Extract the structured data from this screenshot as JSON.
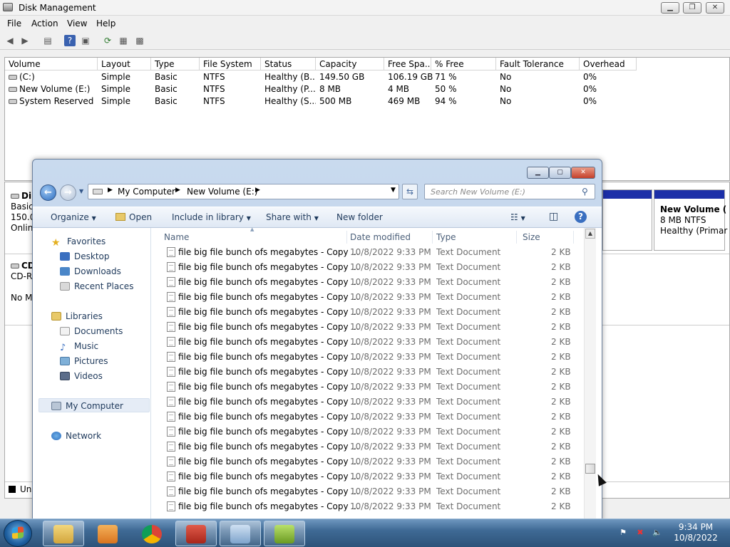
{
  "disk_mgmt": {
    "title": "Disk Management",
    "menu": [
      "File",
      "Action",
      "View",
      "Help"
    ],
    "columns": [
      "Volume",
      "Layout",
      "Type",
      "File System",
      "Status",
      "Capacity",
      "Free Spa...",
      "% Free",
      "Fault Tolerance",
      "Overhead"
    ],
    "rows": [
      [
        "(C:)",
        "Simple",
        "Basic",
        "NTFS",
        "Healthy (B...",
        "149.50 GB",
        "106.19 GB",
        "71 %",
        "No",
        "0%"
      ],
      [
        "New Volume (E:)",
        "Simple",
        "Basic",
        "NTFS",
        "Healthy (P...",
        "8 MB",
        "4 MB",
        "50 %",
        "No",
        "0%"
      ],
      [
        "System Reserved",
        "Simple",
        "Basic",
        "NTFS",
        "Healthy (S...",
        "500 MB",
        "469 MB",
        "94 %",
        "No",
        "0%"
      ]
    ],
    "disk0": {
      "name": "Di",
      "type": "Basic",
      "size": "150.0",
      "status": "Onlin"
    },
    "cdrom": {
      "name": "CD",
      "type": "CD-R",
      "status": "No M"
    },
    "new_volume_box": {
      "title": "New Volume (",
      "size": "8 MB NTFS",
      "status": "Healthy (Primar"
    },
    "legend_unallocated": "Una"
  },
  "explorer": {
    "breadcrumb": [
      "My Computer",
      "New Volume (E:)"
    ],
    "search_placeholder": "Search New Volume (E:)",
    "commands": {
      "organize": "Organize",
      "open": "Open",
      "include": "Include in library",
      "share": "Share with",
      "new_folder": "New folder"
    },
    "nav": {
      "favorites": "Favorites",
      "desktop": "Desktop",
      "downloads": "Downloads",
      "recent": "Recent Places",
      "libraries": "Libraries",
      "documents": "Documents",
      "music": "Music",
      "pictures": "Pictures",
      "videos": "Videos",
      "my_computer": "My Computer",
      "network": "Network"
    },
    "columns": {
      "name": "Name",
      "date": "Date modified",
      "type": "Type",
      "size": "Size"
    },
    "file": {
      "name": "file big file bunch ofs megabytes - Copy ...",
      "date": "10/8/2022 9:33 PM",
      "type": "Text Document",
      "size": "2 KB"
    }
  },
  "taskbar": {
    "time": "9:34 PM",
    "date": "10/8/2022"
  },
  "icons": [
    "back-icon",
    "forward-icon",
    "help-icon",
    "refresh-icon",
    "search-icon",
    "views-icon",
    "preview-pane-icon",
    "chrome-icon",
    "folder-icon",
    "start-orb-icon"
  ]
}
